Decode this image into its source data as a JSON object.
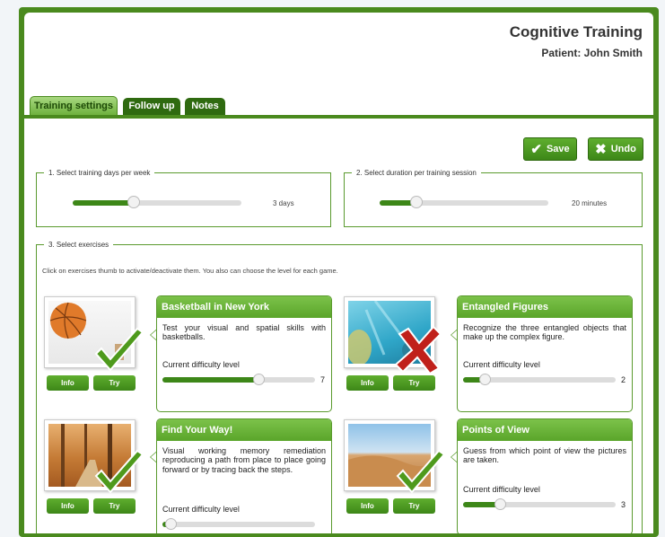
{
  "header": {
    "title": "Cognitive Training",
    "patient": "Patient: John Smith"
  },
  "tabs": [
    {
      "label": "Training settings",
      "active": true
    },
    {
      "label": "Follow up",
      "active": false
    },
    {
      "label": "Notes",
      "active": false
    }
  ],
  "toolbar": {
    "save_label": "Save",
    "undo_label": "Undo"
  },
  "days": {
    "legend": "1. Select training days per week",
    "value_label": "3 days",
    "fraction": 0.36
  },
  "duration": {
    "legend": "2. Select duration per training session",
    "value_label": "20 minutes",
    "fraction": 0.22
  },
  "exercises": {
    "legend": "3. Select exercises",
    "hint": "Click on exercises thumb to activate/deactivate them. You also can choose the level for each game.",
    "info_label": "Info",
    "try_label": "Try",
    "level_label": "Current difficulty level",
    "items": [
      {
        "title": "Basketball in New York",
        "desc": "Test your visual and spatial skills with basketballs.",
        "level": "7",
        "fraction": 0.63,
        "active": true
      },
      {
        "title": "Entangled Figures",
        "desc": "Recognize the three entangled objects that make up the complex figure.",
        "level": "2",
        "fraction": 0.14,
        "active": false
      },
      {
        "title": "Find Your Way!",
        "desc": "Visual working memory remediation reproducing a path from place to place going forward or by tracing back the steps.",
        "level": "",
        "fraction": 0.05,
        "active": true
      },
      {
        "title": "Points of View",
        "desc": "Guess from which point of view the pictures are taken.",
        "level": "3",
        "fraction": 0.24,
        "active": true
      }
    ]
  },
  "colors": {
    "brand_green": "#4a8a1e",
    "check_green": "#4e9a1c",
    "cross_red": "#c0201a"
  }
}
